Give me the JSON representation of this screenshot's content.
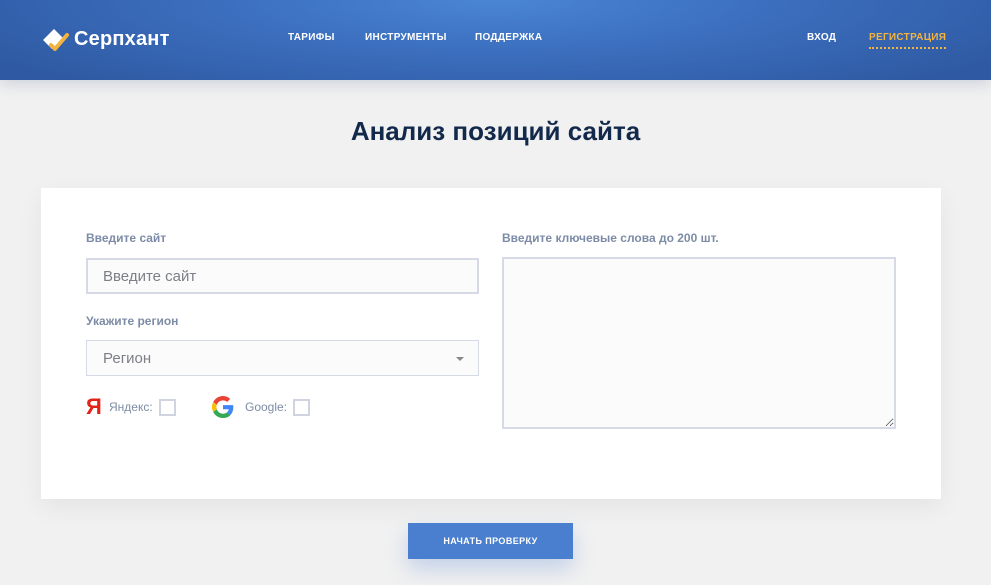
{
  "header": {
    "logo_text": "Серпхант",
    "nav": {
      "tarify": "ТАРИФЫ",
      "tools": "ИНСТРУМЕНТЫ",
      "support": "ПОДДЕРЖКА"
    },
    "login": "ВХОД",
    "register": "РЕГИСТРАЦИЯ"
  },
  "page": {
    "title": "Анализ позиций сайта"
  },
  "form": {
    "site_label": "Введите сайт",
    "site_placeholder": "Введите сайт",
    "region_label": "Укажите регион",
    "region_value": "Регион",
    "keywords_label": "Введите ключевые слова до 200 шт.",
    "yandex_glyph": "Я",
    "yandex_label": "Яндекс:",
    "google_label": "Google:",
    "submit_label": "НАЧАТЬ ПРОВЕРКУ"
  },
  "colors": {
    "header": "#3c6fbf",
    "accent": "#f3b43f",
    "title": "#13294b",
    "button": "#4a7fcf"
  }
}
